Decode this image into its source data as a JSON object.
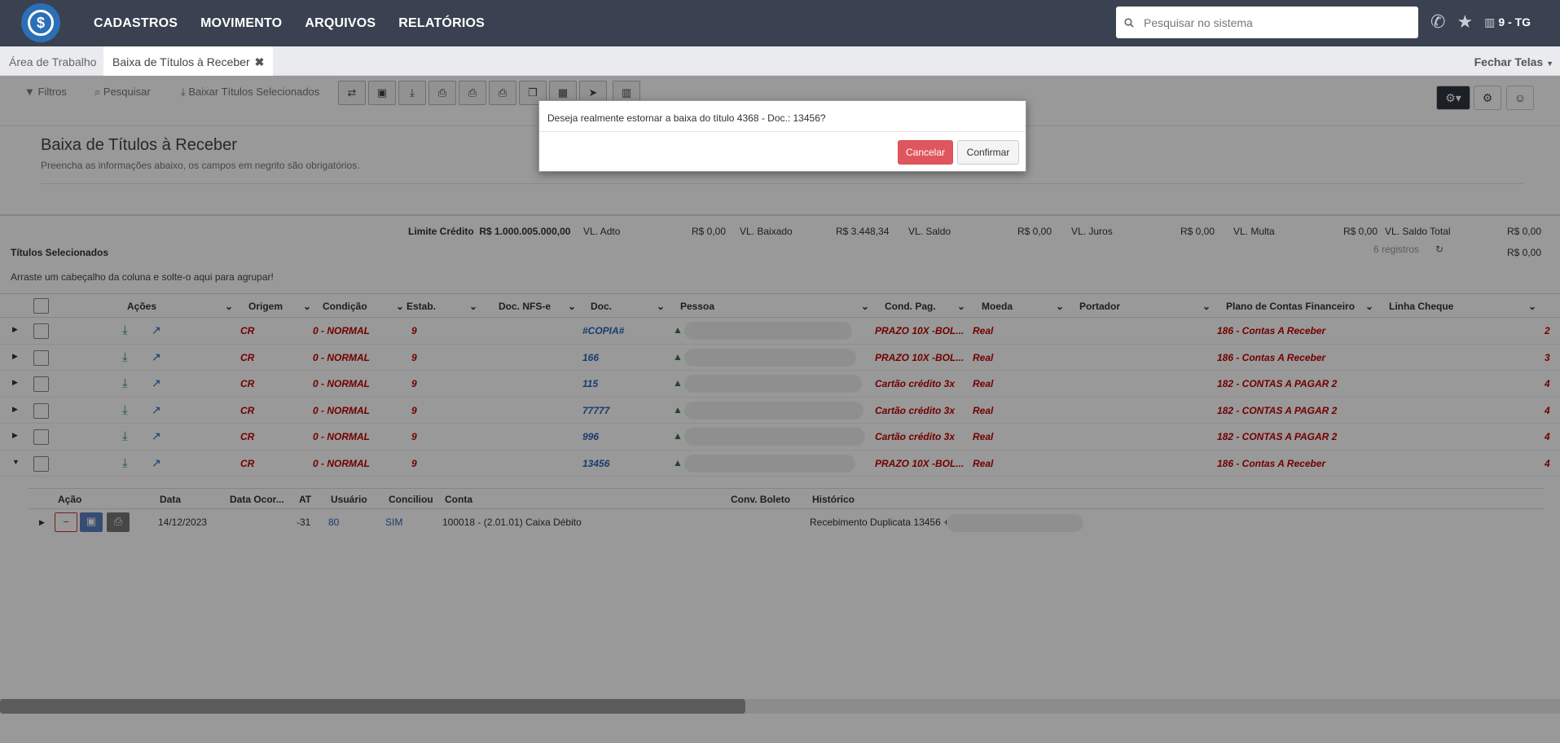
{
  "nav": {
    "menu": [
      "CADASTROS",
      "MOVIMENTO",
      "ARQUIVOS",
      "RELATÓRIOS"
    ],
    "search_placeholder": "Pesquisar no sistema",
    "company": "9 - TG",
    "logo_symbol": "$"
  },
  "tabs": {
    "workarea": "Área de Trabalho",
    "active": "Baixa de Títulos à Receber",
    "close_all": "Fechar Telas"
  },
  "toolbar": {
    "filtros": "Filtros",
    "pesquisar": "Pesquisar",
    "baixar": "Baixar Títulos Selecionados"
  },
  "page": {
    "title": "Baixa de Títulos à Receber",
    "subtitle": "Preencha as informações abaixo, os campos em negrito são obrigatórios."
  },
  "totals": {
    "limite_label": "Limite Crédito",
    "limite_value": "R$ 1.000.005.000,00",
    "adto_label": "VL. Adto",
    "adto_value": "R$ 0,00",
    "baixado_label": "VL. Baixado",
    "baixado_value": "R$ 3.448,34",
    "saldo_label": "VL. Saldo",
    "saldo_value": "R$ 0,00",
    "juros_label": "VL. Juros",
    "juros_value": "R$ 0,00",
    "multa_label": "VL. Multa",
    "multa_value": "R$ 0,00",
    "saldo_total_label": "VL. Saldo Total",
    "saldo_total_value": "R$ 0,00",
    "saldo_total_value2": "R$ 0,00",
    "selected_label": "Títulos Selecionados",
    "registros": "6 registros",
    "drag_hint": "Arraste um cabeçalho da coluna e solte-o aqui para agrupar!"
  },
  "grid": {
    "headers": {
      "acoes": "Ações",
      "origem": "Origem",
      "condicao": "Condição",
      "estab": "Estab.",
      "docnfse": "Doc. NFS-e",
      "doc": "Doc.",
      "pessoa": "Pessoa",
      "condpag": "Cond. Pag.",
      "moeda": "Moeda",
      "portador": "Portador",
      "plano": "Plano de Contas Financeiro",
      "cheque": "Linha Cheque"
    },
    "rows": [
      {
        "origem": "CR",
        "condicao": "0 - NORMAL",
        "estab": "9",
        "doc": "#COPIA#",
        "condpag": "PRAZO 10X -BOL...",
        "moeda": "Real",
        "plano": "186 - Contas A Receber",
        "edge": "2"
      },
      {
        "origem": "CR",
        "condicao": "0 - NORMAL",
        "estab": "9",
        "doc": "166",
        "condpag": "PRAZO 10X -BOL...",
        "moeda": "Real",
        "plano": "186 - Contas A Receber",
        "edge": "3"
      },
      {
        "origem": "CR",
        "condicao": "0 - NORMAL",
        "estab": "9",
        "doc": "115",
        "condpag": "Cartão crédito 3x",
        "moeda": "Real",
        "plano": "182 - CONTAS A PAGAR 2",
        "edge": "4"
      },
      {
        "origem": "CR",
        "condicao": "0 - NORMAL",
        "estab": "9",
        "doc": "77777",
        "condpag": "Cartão crédito 3x",
        "moeda": "Real",
        "plano": "182 - CONTAS A PAGAR 2",
        "edge": "4"
      },
      {
        "origem": "CR",
        "condicao": "0 - NORMAL",
        "estab": "9",
        "doc": "996",
        "condpag": "Cartão crédito 3x",
        "moeda": "Real",
        "plano": "182 - CONTAS A PAGAR 2",
        "edge": "4"
      },
      {
        "origem": "CR",
        "condicao": "0 - NORMAL",
        "estab": "9",
        "doc": "13456",
        "condpag": "PRAZO 10X -BOL...",
        "moeda": "Real",
        "plano": "186 - Contas A Receber",
        "edge": "4"
      }
    ]
  },
  "detail": {
    "headers": {
      "acao": "Ação",
      "data": "Data",
      "dataocor": "Data Ocor...",
      "at": "AT",
      "usuario": "Usuário",
      "conciliou": "Conciliou",
      "conta": "Conta",
      "convboleto": "Conv. Boleto",
      "historico": "Histórico"
    },
    "row": {
      "data": "14/12/2023",
      "at": "-31",
      "usuario": "80",
      "conciliou": "SIM",
      "conta": "100018 - (2.01.01) Caixa Débito",
      "historico": "Recebimento Duplicata 13456 +"
    }
  },
  "dialog": {
    "message": "Deseja realmente estornar a baixa do título 4368 - Doc.: 13456?",
    "cancel": "Cancelar",
    "confirm": "Confirmar"
  }
}
